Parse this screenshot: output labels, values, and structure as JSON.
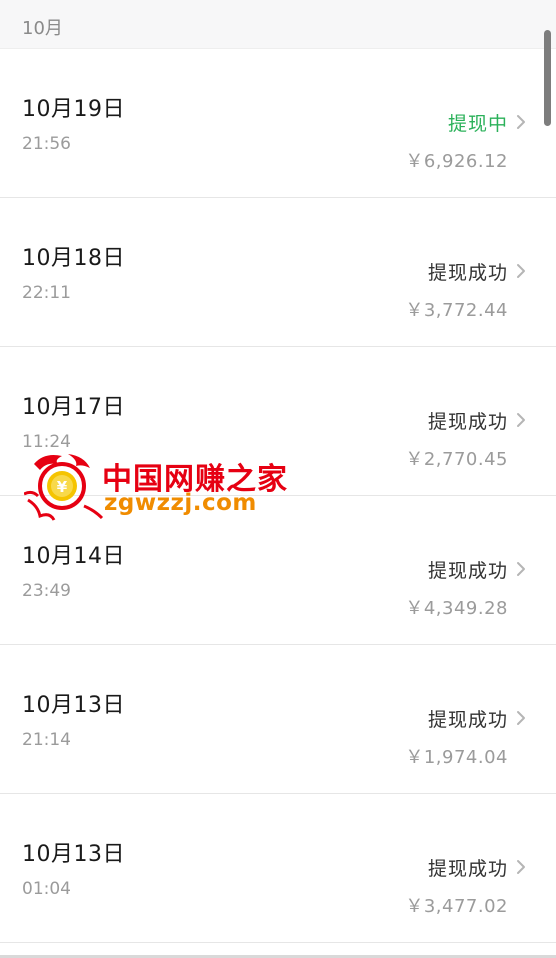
{
  "section": {
    "label": "10月"
  },
  "records": [
    {
      "date": "10月19日",
      "time": "21:56",
      "status": "提现中",
      "amount": "￥6,926.12",
      "pending": true
    },
    {
      "date": "10月18日",
      "time": "22:11",
      "status": "提现成功",
      "amount": "￥3,772.44",
      "pending": false
    },
    {
      "date": "10月17日",
      "time": "11:24",
      "status": "提现成功",
      "amount": "￥2,770.45",
      "pending": false
    },
    {
      "date": "10月14日",
      "time": "23:49",
      "status": "提现成功",
      "amount": "￥4,349.28",
      "pending": false
    },
    {
      "date": "10月13日",
      "time": "21:14",
      "status": "提现成功",
      "amount": "￥1,974.04",
      "pending": false
    },
    {
      "date": "10月13日",
      "time": "01:04",
      "status": "提现成功",
      "amount": "￥3,477.02",
      "pending": false
    }
  ],
  "icons": {
    "row_arrow": "chevron-right-icon"
  },
  "colors": {
    "pending": "#2bb15a",
    "watermark_red": "#e60012",
    "watermark_orange": "#f08c00"
  },
  "watermark": {
    "title": "中国网赚之家",
    "domain": "zgwzzj.com"
  }
}
